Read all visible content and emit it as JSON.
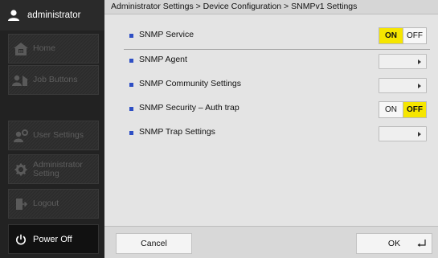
{
  "sidebar": {
    "user": {
      "icon": "user-icon",
      "name": "administrator"
    },
    "items": [
      {
        "icon": "home-icon",
        "label": "Home"
      },
      {
        "icon": "job-buttons-icon",
        "label": "Job Buttons"
      },
      {
        "icon": "user-settings-icon",
        "label": "User Settings"
      },
      {
        "icon": "admin-gear-icon",
        "label_line1": "Administrator",
        "label_line2": "Setting"
      },
      {
        "icon": "logout-icon",
        "label": "Logout"
      }
    ],
    "power": {
      "icon": "power-icon",
      "label": "Power Off"
    }
  },
  "main": {
    "breadcrumb": "Administrator Settings > Device Configuration > SNMPv1 Settings",
    "rows": [
      {
        "label": "SNMP Service",
        "control": "toggle",
        "on_label": "ON",
        "off_label": "OFF",
        "selected": "ON"
      },
      {
        "label": "SNMP Agent",
        "control": "nav"
      },
      {
        "label": "SNMP Community Settings",
        "control": "nav"
      },
      {
        "label": "SNMP Security – Auth trap",
        "control": "toggle",
        "on_label": "ON",
        "off_label": "OFF",
        "selected": "OFF"
      },
      {
        "label": "SNMP Trap Settings",
        "control": "nav"
      }
    ],
    "footer": {
      "cancel_label": "Cancel",
      "ok_label": "OK"
    }
  },
  "colors": {
    "accent_yellow": "#f6e600",
    "bullet_blue": "#2e4fc4",
    "sidebar_bg": "#222222",
    "panel_bg": "#e4e4e4"
  }
}
